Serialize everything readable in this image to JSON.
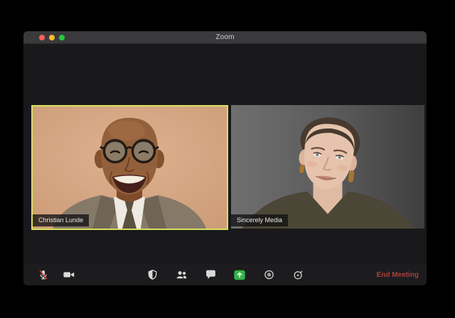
{
  "window": {
    "title": "Zoom",
    "controls": {
      "close_color": "#ff5f57",
      "minimize_color": "#febc2e",
      "fullscreen_color": "#28c840"
    }
  },
  "video_grid": {
    "tiles": [
      {
        "name_label": "Christian Lunde",
        "active_speaker": true,
        "active_border_color": "#d7e05f"
      },
      {
        "name_label": "Sincerely Media",
        "active_speaker": false
      }
    ]
  },
  "toolbar": {
    "left_icons": [
      "microphone-muted-icon",
      "video-camera-icon"
    ],
    "center_icons": [
      "security-shield-icon",
      "participants-icon",
      "chat-bubble-icon",
      "share-screen-icon",
      "record-icon",
      "stopwatch-icon"
    ],
    "share_screen_color": "#32b34a",
    "mute_slash_color": "#e23b36",
    "end_meeting_label": "End Meeting",
    "end_meeting_color": "#a6413c"
  }
}
